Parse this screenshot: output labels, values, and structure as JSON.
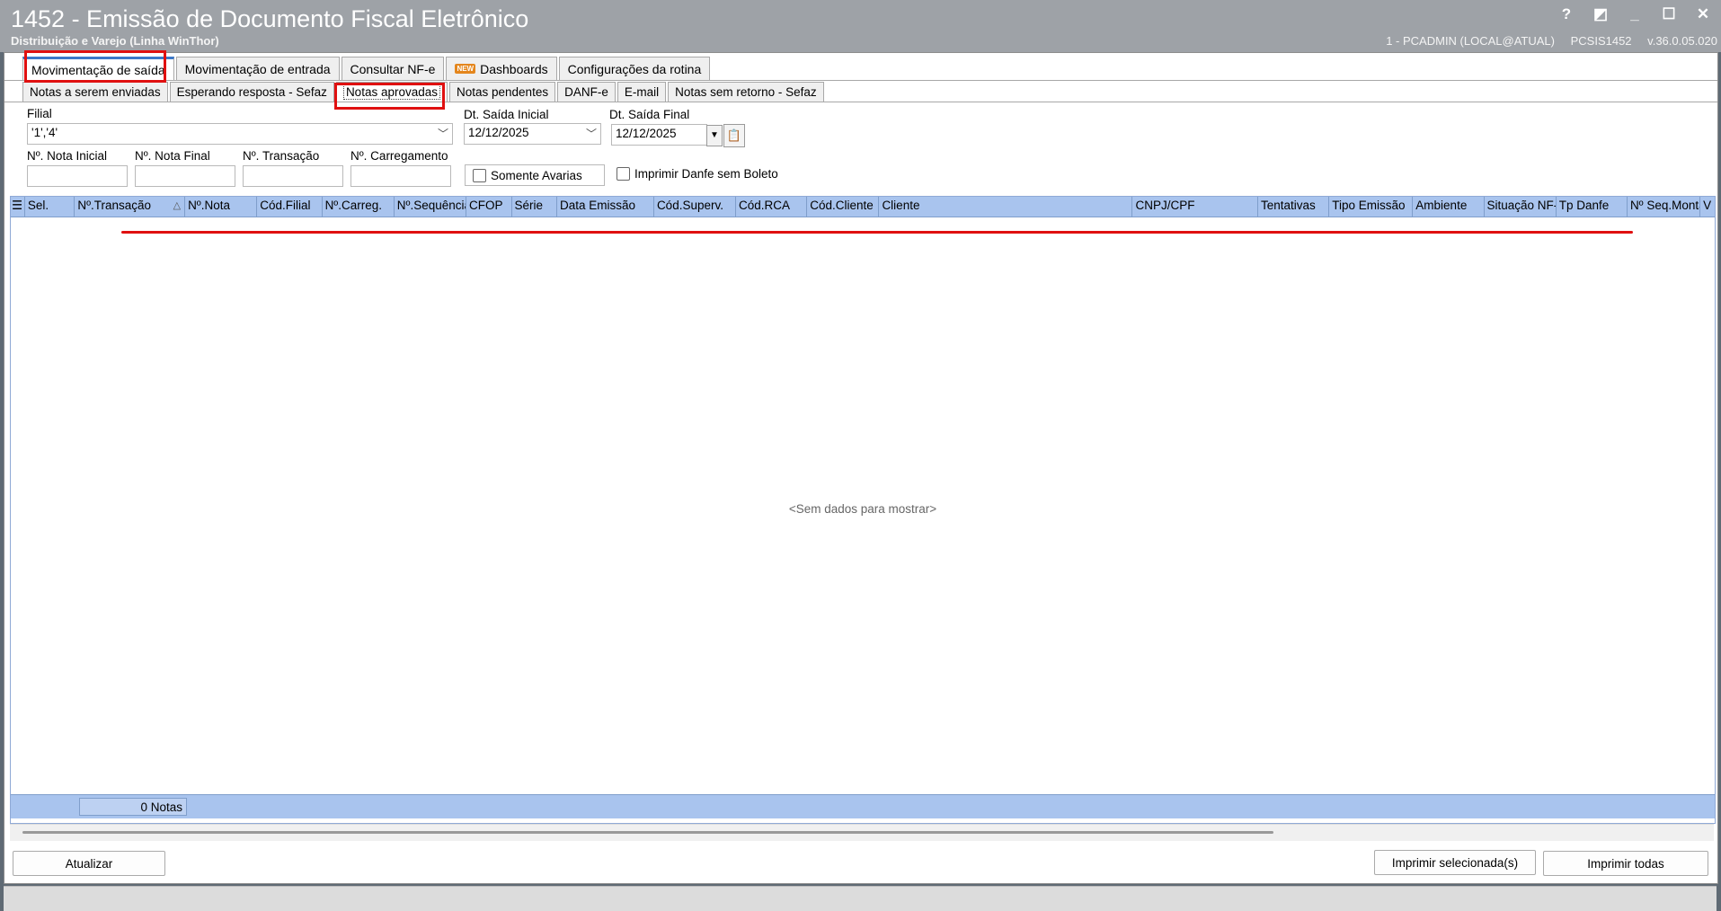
{
  "window": {
    "title": "1452 - Emissão de Documento Fiscal Eletrônico",
    "subtitle": "Distribuição e Varejo (Linha WinThor)",
    "status_user": "1 - PCADMIN (LOCAL@ATUAL)",
    "status_routine": "PCSIS1452",
    "status_version": "v.36.0.05.020",
    "controls": {
      "help": "?",
      "restore": "◩",
      "minimize": "_",
      "maximize": "☐",
      "close": "✕"
    }
  },
  "tabs_main": [
    {
      "label": "Movimentação de saída",
      "active": true
    },
    {
      "label": "Movimentação de entrada"
    },
    {
      "label": "Consultar NF-e"
    },
    {
      "label": "Dashboards",
      "badge": "NEW"
    },
    {
      "label": "Configurações da rotina"
    }
  ],
  "tabs_sub": [
    {
      "label": "Notas a serem enviadas"
    },
    {
      "label": "Esperando resposta - Sefaz"
    },
    {
      "label": "Notas aprovadas",
      "active": true
    },
    {
      "label": "Notas pendentes"
    },
    {
      "label": "DANF-e"
    },
    {
      "label": "E-mail"
    },
    {
      "label": "Notas sem retorno - Sefaz"
    }
  ],
  "filters": {
    "filial_label": "Filial",
    "filial_value": "'1','4'",
    "dt_inicial_label": "Dt. Saída Inicial",
    "dt_inicial_value": "12/12/2025",
    "dt_final_label": "Dt. Saída Final",
    "dt_final_value": "12/12/2025",
    "nota_inicial_label": "Nº. Nota Inicial",
    "nota_final_label": "Nº. Nota Final",
    "transacao_label": "Nº. Transação",
    "carregamento_label": "Nº. Carregamento",
    "somente_avarias_label": "Somente Avarias",
    "imprimir_danfe_label": "Imprimir Danfe sem Boleto"
  },
  "grid": {
    "columns": [
      "Sel.",
      "Nº.Transação",
      "Nº.Nota",
      "Cód.Filial",
      "Nº.Carreg.",
      "Nº.Sequência",
      "CFOP",
      "Série",
      "Data Emissão",
      "Cód.Superv.",
      "Cód.RCA",
      "Cód.Cliente",
      "Cliente",
      "CNPJ/CPF",
      "Tentativas",
      "Tipo Emissão",
      "Ambiente",
      "Situação NF-e",
      "Tp Danfe",
      "Nº Seq.Montagem",
      "V"
    ],
    "empty_message": "<Sem dados para mostrar>",
    "footer_count": "0 Notas"
  },
  "buttons": {
    "atualizar": "Atualizar",
    "imprimir_selecionadas": "Imprimir selecionada(s)",
    "imprimir_todas": "Imprimir todas"
  },
  "colors": {
    "accent_red": "#e01010",
    "grid_header": "#a9c4ee",
    "titlebar": "#9ea2a7"
  }
}
